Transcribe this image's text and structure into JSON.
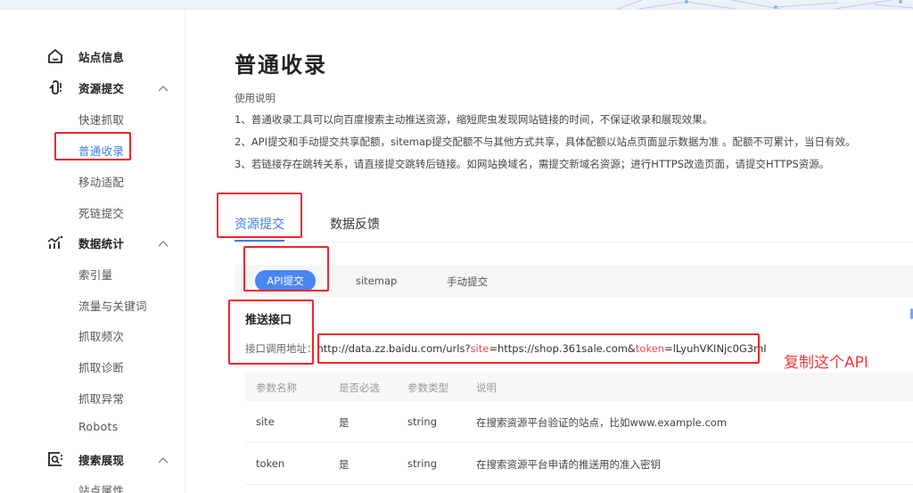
{
  "sidebar": {
    "groups": [
      {
        "label": "站点信息",
        "icon": "home-icon",
        "expanded": null
      },
      {
        "label": "资源提交",
        "icon": "submit-hook-icon",
        "expanded": true,
        "items": [
          "快速抓取",
          "普通收录",
          "移动适配",
          "死链提交"
        ]
      },
      {
        "label": "数据统计",
        "icon": "stats-chart-icon",
        "expanded": true,
        "items": [
          "索引量",
          "流量与关键词",
          "抓取频次",
          "抓取诊断",
          "抓取异常",
          "Robots"
        ]
      },
      {
        "label": "搜索展现",
        "icon": "search-display-icon",
        "expanded": true,
        "items": [
          "站点属性"
        ]
      }
    ],
    "active_item": "普通收录"
  },
  "main": {
    "title": "普通收录",
    "usage": {
      "heading": "使用说明",
      "lines": [
        "1、普通收录工具可以向百度搜索主动推送资源，缩短爬虫发现网站链接的时间，不保证收录和展现效果。",
        "2、API提交和手动提交共享配额，sitemap提交配额不与其他方式共享，具体配额以站点页面显示数据为准 。配额不可累计，当日有效。",
        "3、若链接存在跳转关系，请直接提交跳转后链接。如网站换域名，需提交新域名资源；进行HTTPS改造页面，请提交HTTPS资源。"
      ]
    },
    "tabs": [
      {
        "label": "资源提交",
        "active": true
      },
      {
        "label": "数据反馈",
        "active": false
      }
    ],
    "subtabs": [
      {
        "label": "API提交",
        "active": true
      },
      {
        "label": "sitemap",
        "active": false
      },
      {
        "label": "手动提交",
        "active": false
      }
    ],
    "push_api": {
      "title": "推送接口",
      "address_label": "接口调用地址：",
      "url_parts": {
        "prefix": "http://data.zz.baidu.com/urls?",
        "site_key": "site",
        "site_value": "=https://shop.361sale.com&",
        "token_key": "token",
        "token_value": "=lLyuhVKINjc0G3mI"
      }
    },
    "annotation": "复制这个API",
    "params_table": {
      "headers": [
        "参数名称",
        "是否必选",
        "参数类型",
        "说明"
      ],
      "rows": [
        [
          "site",
          "是",
          "string",
          "在搜索资源平台验证的站点，比如www.example.com"
        ],
        [
          "token",
          "是",
          "string",
          "在搜索资源平台申请的推送用的准入密钥"
        ]
      ]
    }
  },
  "colors": {
    "accent": "#3d7fe6",
    "pill": "#4a86f0",
    "highlight_red": "#f0262a",
    "param_red": "#f0484e"
  }
}
